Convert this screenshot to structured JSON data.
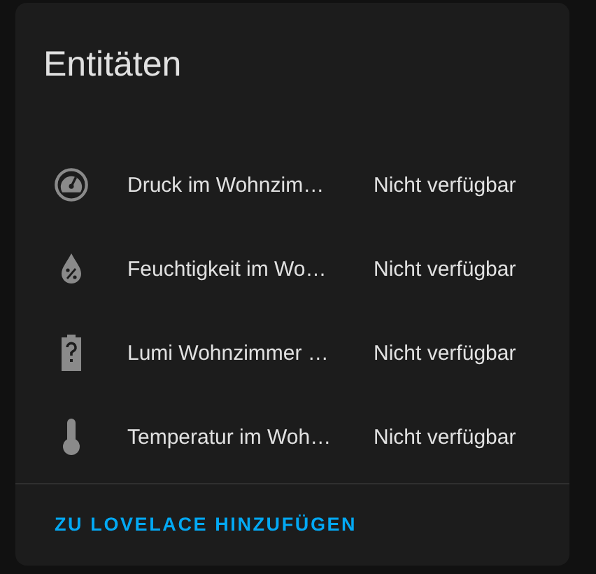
{
  "card": {
    "title": "Entitäten",
    "entities": [
      {
        "kind": "gauge",
        "name": "Druck im Wohnzim…",
        "state": "Nicht verfügbar"
      },
      {
        "kind": "humidity",
        "name": "Feuchtigkeit im Wo…",
        "state": "Nicht verfügbar"
      },
      {
        "kind": "battery",
        "name": "Lumi Wohnzimmer …",
        "state": "Nicht verfügbar"
      },
      {
        "kind": "thermometer",
        "name": "Temperatur im Woh…",
        "state": "Nicht verfügbar"
      }
    ],
    "action": "ZU LOVELACE HINZUFÜGEN"
  }
}
